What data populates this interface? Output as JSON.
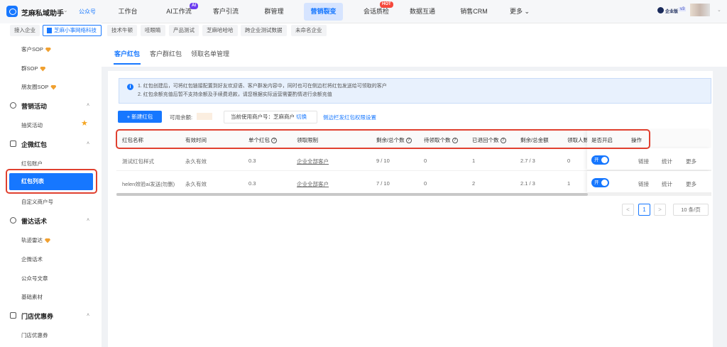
{
  "brand": {
    "name": "芝麻私域助手",
    "account_type": "公众号"
  },
  "nav": [
    {
      "label": "工作台"
    },
    {
      "label": "AI工作流",
      "badge": "AI"
    },
    {
      "label": "客户引流"
    },
    {
      "label": "群管理"
    },
    {
      "label": "营销裂变",
      "active": true
    },
    {
      "label": "会话质检",
      "badge": "HOT"
    },
    {
      "label": "数据互通"
    },
    {
      "label": "销售CRM"
    },
    {
      "label": "更多 ⌄"
    }
  ],
  "user": {
    "edition": "企业版",
    "version": "v3"
  },
  "subtabs": [
    "接入企业",
    "芝麻小事网络科技",
    "技术牛顿",
    "哇眼睛",
    "产品测试",
    "芝麻哈哈哈",
    "跨企业测试数据",
    "未命名企业"
  ],
  "sidebar": {
    "items": [
      "客户SOP",
      "群SOP",
      "朋友圈SOP"
    ],
    "groups": [
      {
        "label": "营销活动",
        "items": [
          "抽奖活动"
        ]
      },
      {
        "label": "企微红包",
        "items": [
          "红包账户",
          "红包列表",
          "自定义商户号"
        ]
      },
      {
        "label": "雷达话术",
        "items": [
          "轨迹雷达",
          "企微话术",
          "公众号文章",
          "基础素材"
        ]
      },
      {
        "label": "门店优惠券",
        "items": [
          "门店优惠券"
        ]
      }
    ],
    "selected": "红包列表"
  },
  "tabs": [
    "客户红包",
    "客户群红包",
    "领取名单管理"
  ],
  "notice": [
    "1. 红包创建后，可将红包链接配置到好友欢迎语、客户群发内容中，同时也可在侧边栏将红包发送给可领取的客户",
    "2. 红包余额充值后暂不支持余额及手续费退款，请您根据实际运营需要酌情进行余额充值"
  ],
  "toolbar": {
    "new_button": "+ 新建红包",
    "balance_label": "可用余额:",
    "merchant_label": "当前使用商户号：芝麻商户",
    "switch": "切换",
    "sidebar_perm": "侧边栏发红包权限设置"
  },
  "table": {
    "headers": [
      "红包名称",
      "有效时间",
      "单个红包",
      "领取限制",
      "剩余/总个数",
      "待领取个数",
      "已退回个数",
      "剩余/总金额",
      "领取人数",
      "是否开启",
      "操作"
    ],
    "rows": [
      [
        "测试红包样式",
        "永久有效",
        "0.3",
        "企业全部客户",
        "9 / 10",
        "0",
        "1",
        "2.7 / 3",
        "0"
      ],
      [
        "helen效验ai发送(勿删)",
        "永久有效",
        "0.3",
        "企业全部客户",
        "7 / 10",
        "0",
        "2",
        "2.1 / 3",
        "1"
      ]
    ],
    "toggle_label": "开",
    "actions": [
      "链接",
      "统计",
      "更多"
    ]
  },
  "pagination": {
    "prev": "<",
    "current": "1",
    "next": ">",
    "page_size": "10 条/页"
  }
}
